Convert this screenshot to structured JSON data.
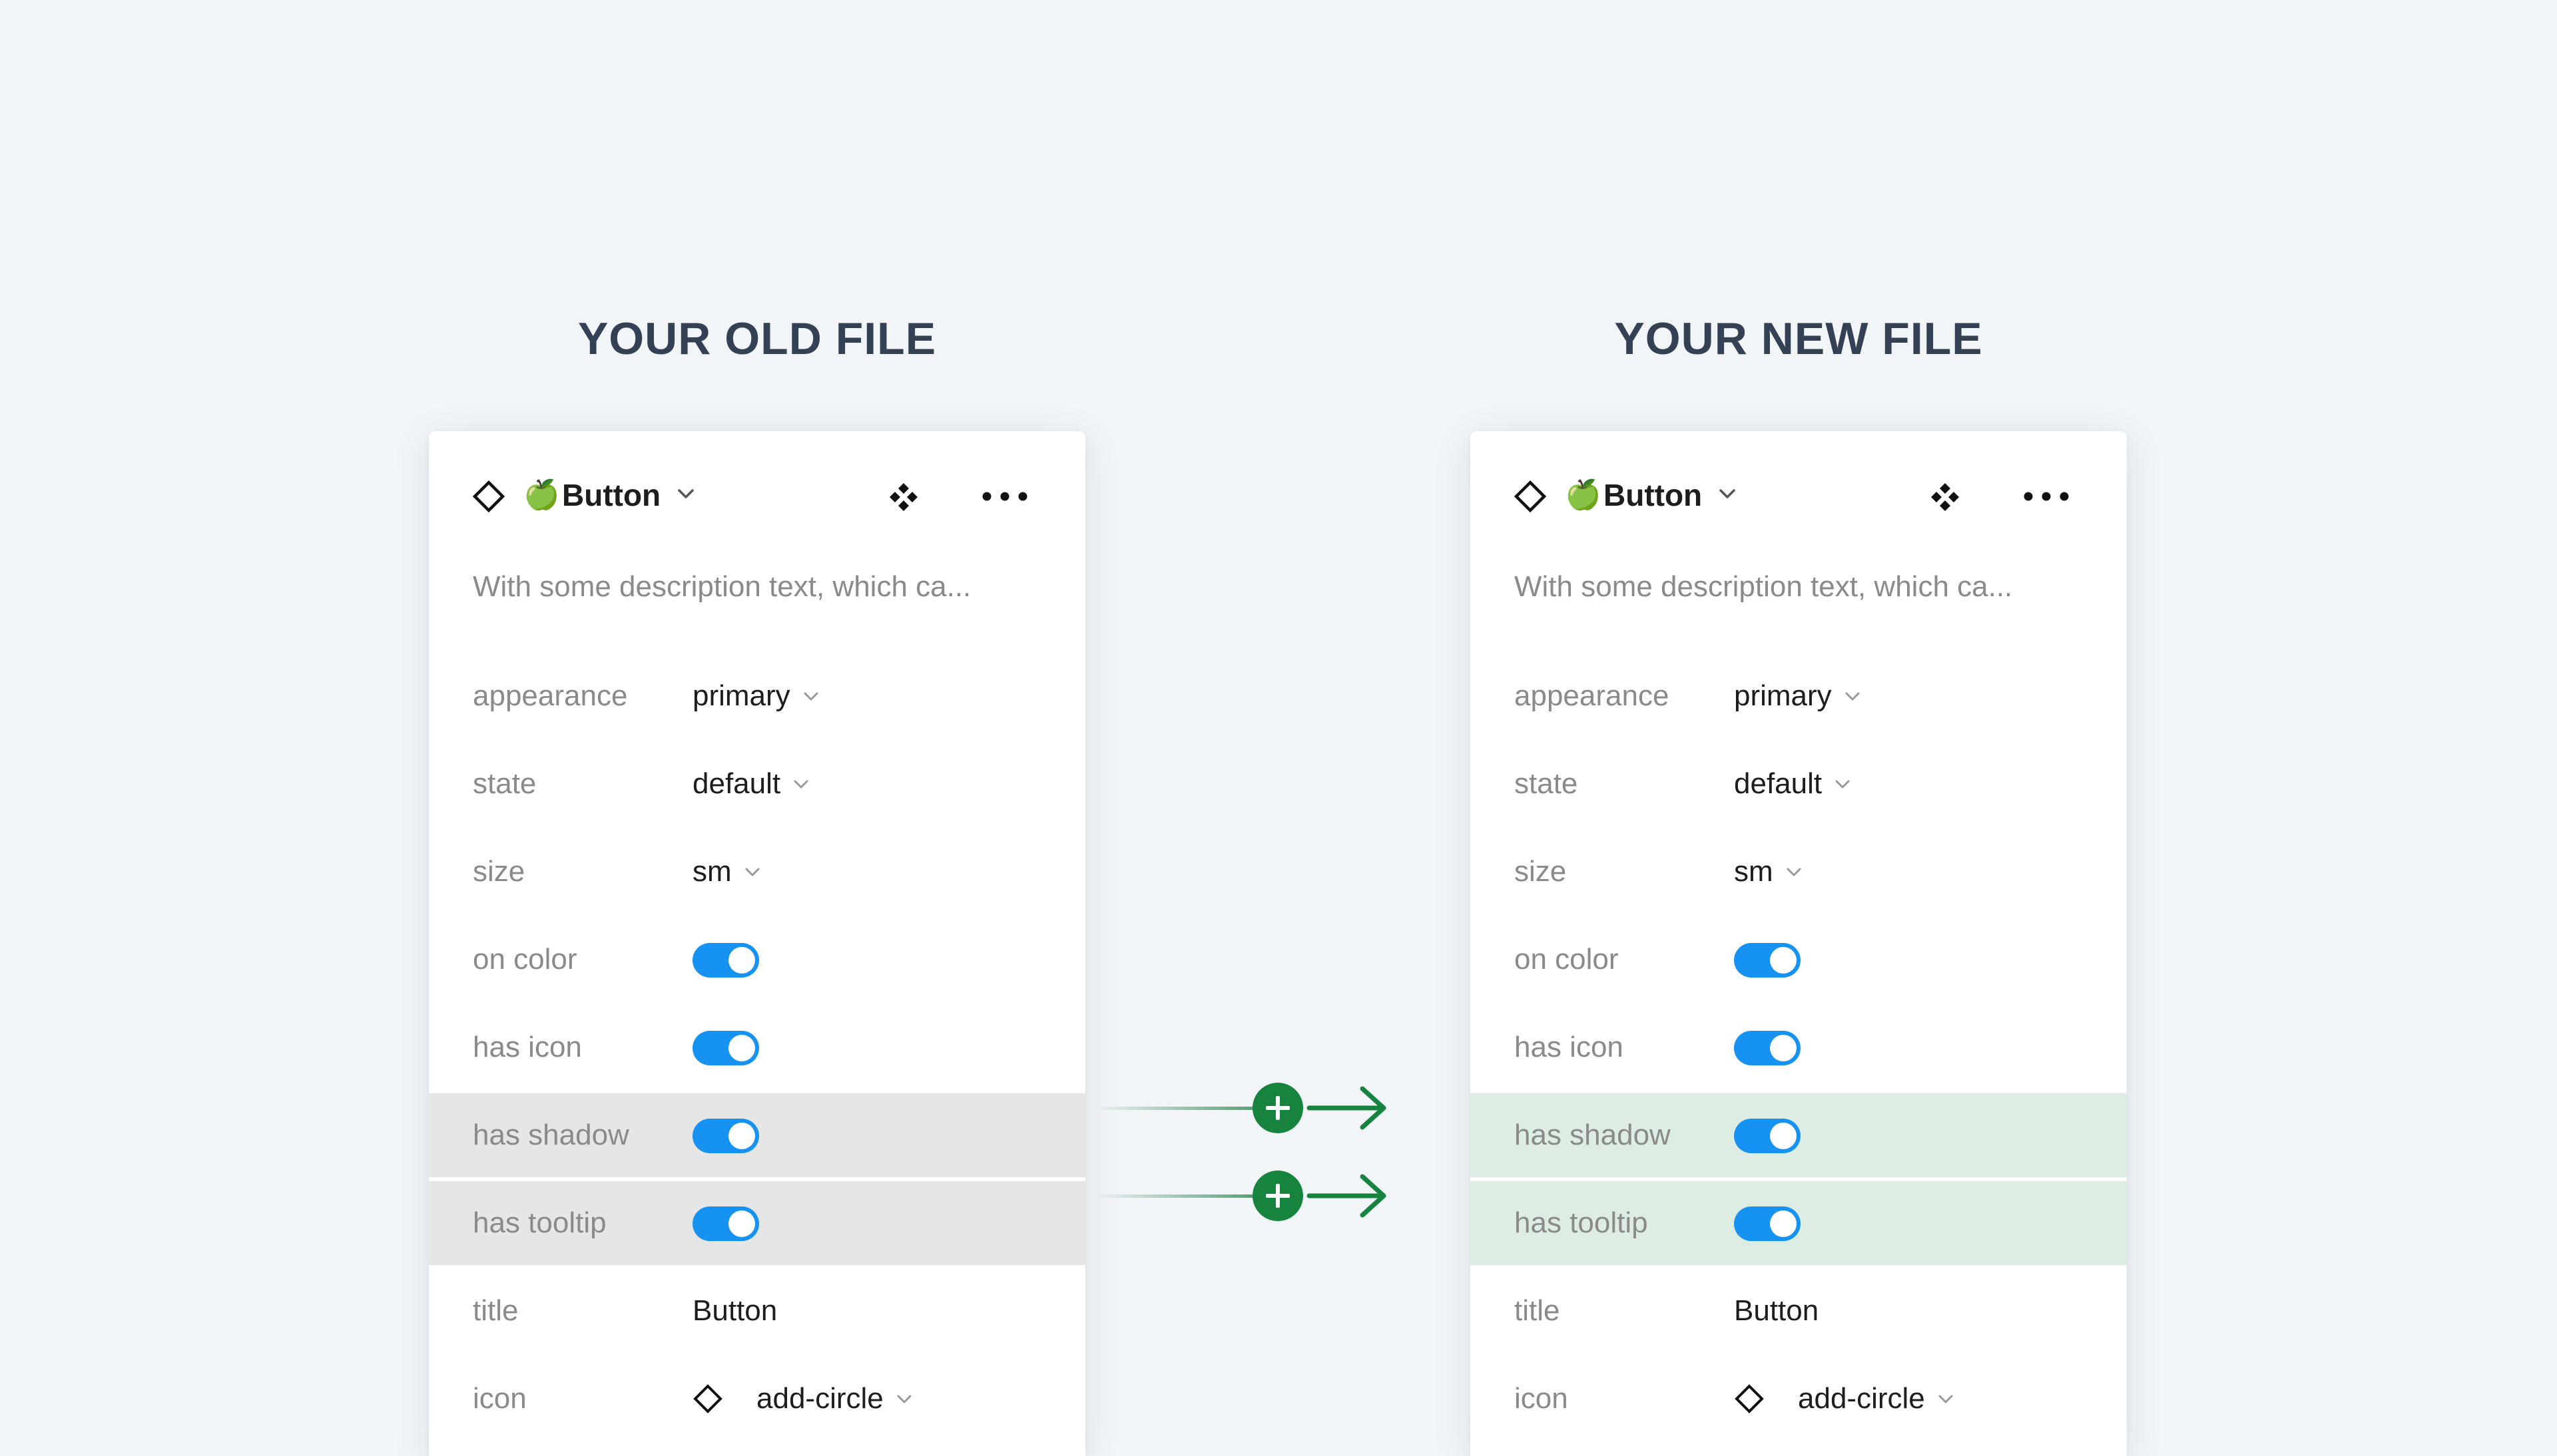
{
  "headings": {
    "old": "YOUR OLD FILE",
    "new": "YOUR NEW FILE"
  },
  "panel": {
    "component_emoji": "🍏",
    "component_name": "Button",
    "description": "With some description text, which ca...",
    "rows": [
      {
        "label": "appearance",
        "value": "primary",
        "kind": "dropdown"
      },
      {
        "label": "state",
        "value": "default",
        "kind": "dropdown"
      },
      {
        "label": "size",
        "value": "sm",
        "kind": "dropdown"
      },
      {
        "label": "on color",
        "kind": "toggle",
        "on": true
      },
      {
        "label": "has icon",
        "kind": "toggle",
        "on": true
      },
      {
        "label": "has shadow",
        "kind": "toggle",
        "on": true,
        "highlight": true
      },
      {
        "label": "has tooltip",
        "kind": "toggle",
        "on": true,
        "highlight": true
      },
      {
        "label": "title",
        "value": "Button",
        "kind": "text"
      },
      {
        "label": "icon",
        "value": "add-circle",
        "kind": "icon-dropdown"
      }
    ]
  },
  "colors": {
    "toggle_on": "#1592f2",
    "highlight_old": "#e6e6e6",
    "highlight_new": "#ddede3",
    "connector_green": "#16843e"
  },
  "icons": {
    "component": "diamond-outline-icon",
    "variants": "component-variants-icon",
    "more": "more-horizontal-icon",
    "chevron": "chevron-down-icon",
    "add": "add-circle-icon",
    "arrow": "arrow-right-icon"
  }
}
